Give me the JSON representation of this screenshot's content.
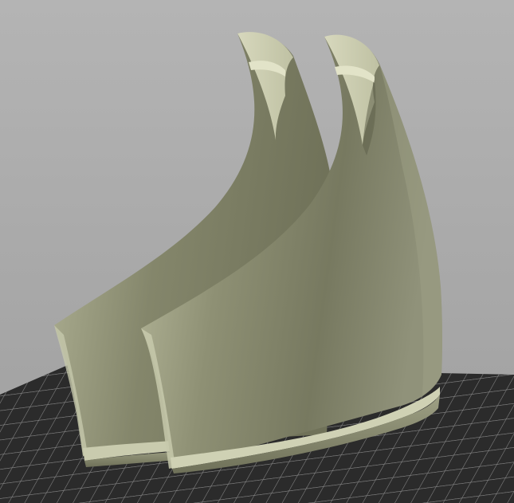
{
  "viewport": {
    "background_top": "#b5b5b5",
    "background_bottom": "#9e9e9e"
  },
  "build_plate": {
    "fill": "#2c2c2c",
    "grid_color": "#8a8a8a"
  },
  "model": {
    "base_color": "#a6a88a",
    "highlight_color": "#d7d8bd",
    "shadow_color": "#6f7159",
    "edge_color": "#c9cbab"
  }
}
